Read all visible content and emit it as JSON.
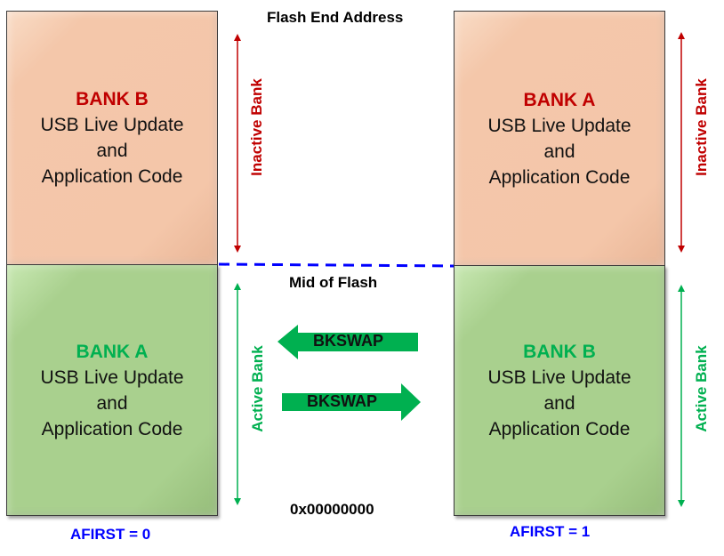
{
  "diagram": {
    "top_label": "Flash End Address",
    "mid_label": "Mid of Flash",
    "bottom_label": "0x00000000",
    "colors": {
      "inactive": "#c00000",
      "active": "#00b050",
      "boundary": "#0000ff",
      "inactive_fill": "#f4c6a9",
      "active_fill": "#a9d08e"
    },
    "left_column": {
      "afirst_label": "AFIRST = 0",
      "upper_bank": {
        "title": "BANK B",
        "line1": "USB Live Update",
        "line2": "and",
        "line3": "Application Code",
        "state": "Inactive Bank"
      },
      "lower_bank": {
        "title": "BANK A",
        "line1": "USB Live Update",
        "line2": "and",
        "line3": "Application Code",
        "state": "Active Bank"
      }
    },
    "right_column": {
      "afirst_label": "AFIRST = 1",
      "upper_bank": {
        "title": "BANK A",
        "line1": "USB Live Update",
        "line2": "and",
        "line3": "Application Code",
        "state": "Inactive Bank"
      },
      "lower_bank": {
        "title": "BANK B",
        "line1": "USB Live Update",
        "line2": "and",
        "line3": "Application Code",
        "state": "Active Bank"
      }
    },
    "swap_arrows": [
      {
        "label": "BKSWAP",
        "direction": "left"
      },
      {
        "label": "BKSWAP",
        "direction": "right"
      }
    ]
  }
}
